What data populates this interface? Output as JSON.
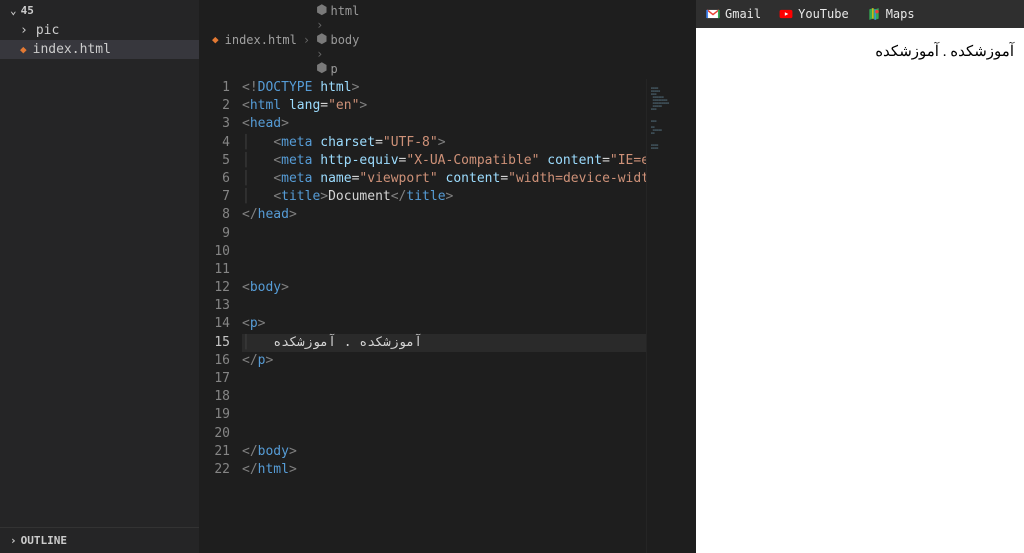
{
  "sidebar": {
    "root_label": "45",
    "items": [
      {
        "label": "pic",
        "type": "folder"
      },
      {
        "label": "index.html",
        "type": "file",
        "active": true
      }
    ],
    "outline_label": "OUTLINE"
  },
  "breadcrumb": {
    "file": "index.html",
    "path": [
      "html",
      "body",
      "p"
    ]
  },
  "editor": {
    "active_line": 15,
    "lines": [
      {
        "n": 1,
        "t": [
          [
            "c-gray",
            "<!"
          ],
          [
            "c-blue",
            "DOCTYPE"
          ],
          [
            "c-attr",
            " html"
          ],
          [
            "c-gray",
            ">"
          ]
        ]
      },
      {
        "n": 2,
        "t": [
          [
            "c-gray",
            "<"
          ],
          [
            "c-blue",
            "html"
          ],
          [
            "c-attr",
            " lang"
          ],
          [
            "c-white",
            "="
          ],
          [
            "c-str",
            "\"en\""
          ],
          [
            "c-gray",
            ">"
          ]
        ]
      },
      {
        "n": 3,
        "t": [
          [
            "c-gray",
            "<"
          ],
          [
            "c-blue",
            "head"
          ],
          [
            "c-gray",
            ">"
          ]
        ]
      },
      {
        "n": 4,
        "i": 1,
        "t": [
          [
            "c-gray",
            "<"
          ],
          [
            "c-blue",
            "meta"
          ],
          [
            "c-attr",
            " charset"
          ],
          [
            "c-white",
            "="
          ],
          [
            "c-str",
            "\"UTF-8\""
          ],
          [
            "c-gray",
            ">"
          ]
        ]
      },
      {
        "n": 5,
        "i": 1,
        "t": [
          [
            "c-gray",
            "<"
          ],
          [
            "c-blue",
            "meta"
          ],
          [
            "c-attr",
            " http-equiv"
          ],
          [
            "c-white",
            "="
          ],
          [
            "c-str",
            "\"X-UA-Compatible\""
          ],
          [
            "c-attr",
            " content"
          ],
          [
            "c-white",
            "="
          ],
          [
            "c-str",
            "\"IE=edge\""
          ],
          [
            "c-gray",
            ">"
          ]
        ]
      },
      {
        "n": 6,
        "i": 1,
        "t": [
          [
            "c-gray",
            "<"
          ],
          [
            "c-blue",
            "meta"
          ],
          [
            "c-attr",
            " name"
          ],
          [
            "c-white",
            "="
          ],
          [
            "c-str",
            "\"viewport\""
          ],
          [
            "c-attr",
            " content"
          ],
          [
            "c-white",
            "="
          ],
          [
            "c-str",
            "\"width=device-width, initial"
          ]
        ]
      },
      {
        "n": 7,
        "i": 1,
        "t": [
          [
            "c-gray",
            "<"
          ],
          [
            "c-blue",
            "title"
          ],
          [
            "c-gray",
            ">"
          ],
          [
            "c-white",
            "Document"
          ],
          [
            "c-gray",
            "</"
          ],
          [
            "c-blue",
            "title"
          ],
          [
            "c-gray",
            ">"
          ]
        ]
      },
      {
        "n": 8,
        "t": [
          [
            "c-gray",
            "</"
          ],
          [
            "c-blue",
            "head"
          ],
          [
            "c-gray",
            ">"
          ]
        ]
      },
      {
        "n": 9,
        "t": []
      },
      {
        "n": 10,
        "t": []
      },
      {
        "n": 11,
        "t": []
      },
      {
        "n": 12,
        "t": [
          [
            "c-gray",
            "<"
          ],
          [
            "c-blue",
            "body"
          ],
          [
            "c-gray",
            ">"
          ]
        ]
      },
      {
        "n": 13,
        "t": []
      },
      {
        "n": 14,
        "t": [
          [
            "c-gray",
            "<"
          ],
          [
            "c-blue",
            "p"
          ],
          [
            "c-gray",
            ">"
          ]
        ]
      },
      {
        "n": 15,
        "i": 1,
        "t": [
          [
            "c-white",
            "آموزشکده . آموزشکده"
          ]
        ]
      },
      {
        "n": 16,
        "t": [
          [
            "c-gray",
            "</"
          ],
          [
            "c-blue",
            "p"
          ],
          [
            "c-gray",
            ">"
          ]
        ]
      },
      {
        "n": 17,
        "t": []
      },
      {
        "n": 18,
        "t": []
      },
      {
        "n": 19,
        "t": []
      },
      {
        "n": 20,
        "t": []
      },
      {
        "n": 21,
        "t": [
          [
            "c-gray",
            "</"
          ],
          [
            "c-blue",
            "body"
          ],
          [
            "c-gray",
            ">"
          ]
        ]
      },
      {
        "n": 22,
        "t": [
          [
            "c-gray",
            "</"
          ],
          [
            "c-blue",
            "html"
          ],
          [
            "c-gray",
            ">"
          ]
        ]
      }
    ]
  },
  "browser": {
    "bookmarks": [
      {
        "label": "Gmail",
        "icon": "gmail"
      },
      {
        "label": "YouTube",
        "icon": "youtube"
      },
      {
        "label": "Maps",
        "icon": "maps"
      }
    ],
    "page_text": "آموزشکده . آموزشکده"
  }
}
